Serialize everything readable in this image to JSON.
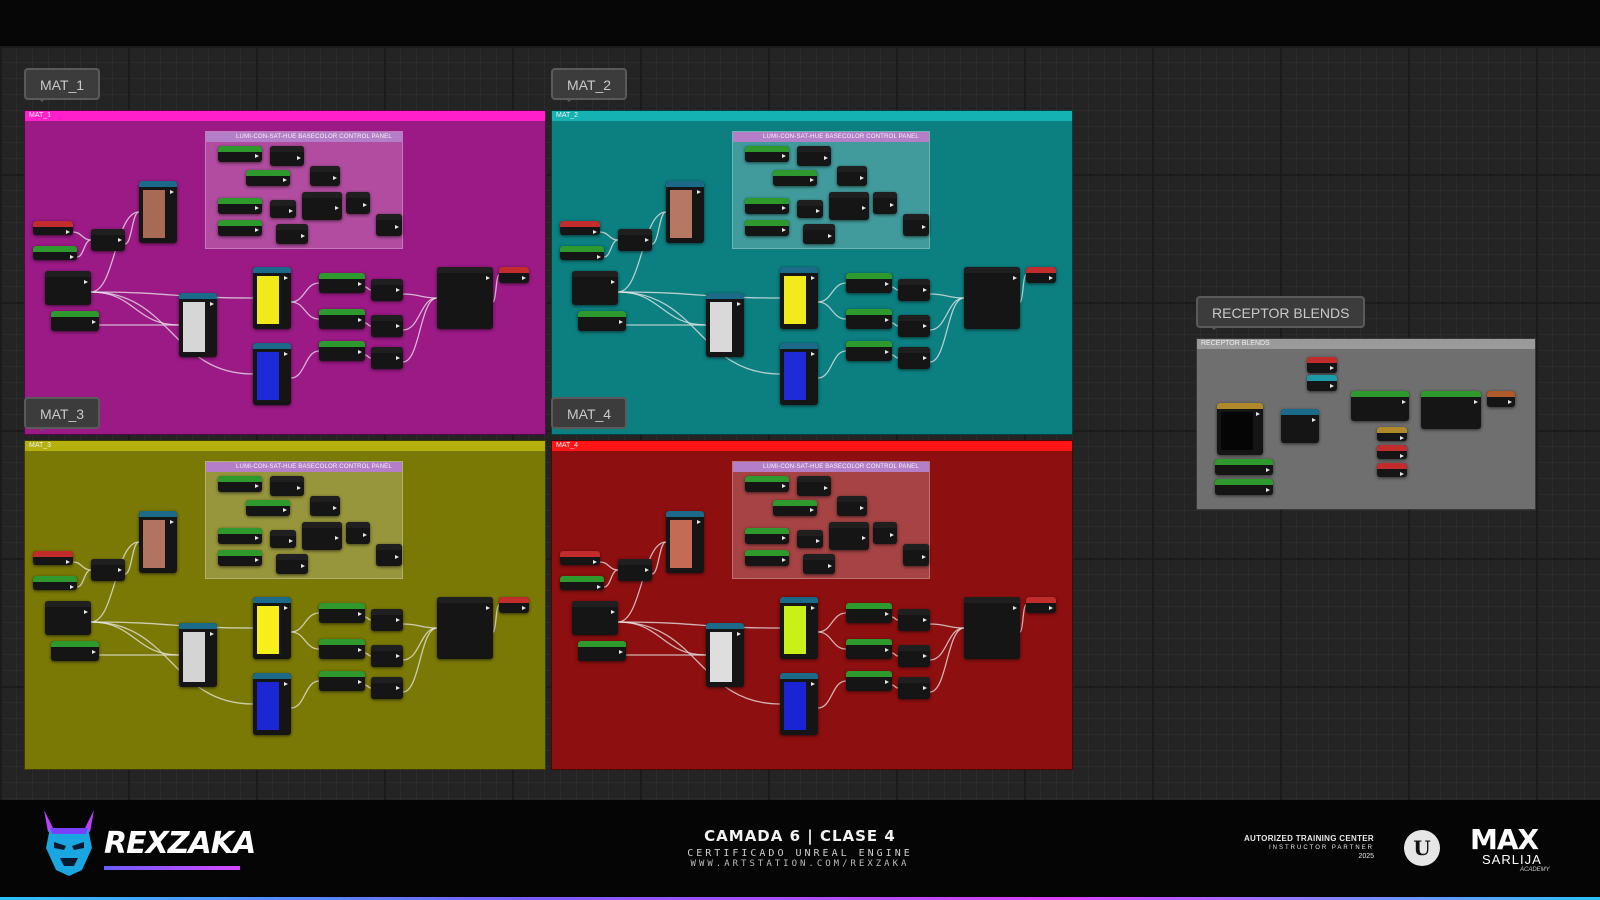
{
  "graph": {
    "groups": [
      {
        "tag": "MAT_1",
        "bar_label": "MAT_1",
        "color": "#9b1a86",
        "bar_color": "#ff1fcb",
        "swatches": [
          "#a86a54",
          "#f0e91c",
          "#d6d6d6",
          "#1c2ad8"
        ]
      },
      {
        "tag": "MAT_2",
        "bar_label": "MAT_2",
        "color": "#0c7f80",
        "bar_color": "#14b2b2",
        "swatches": [
          "#b67863",
          "#f4e91a",
          "#d9d9d9",
          "#1f2ad8"
        ]
      },
      {
        "tag": "MAT_3",
        "bar_label": "MAT_3",
        "color": "#7b7906",
        "bar_color": "#b4b10e",
        "swatches": [
          "#b27461",
          "#f8ef1a",
          "#d4d4d4",
          "#1b27d2"
        ]
      },
      {
        "tag": "MAT_4",
        "bar_label": "MAT_4",
        "color": "#8d0f10",
        "bar_color": "#ff1515",
        "swatches": [
          "#c46a55",
          "#c9f017",
          "#dedede",
          "#1a24d4"
        ]
      }
    ],
    "panel_title": "LUMI-CON-SAT-HUE BASECOLOR CONTROL PANEL",
    "receptor": {
      "tag": "RECEPTOR BLENDS",
      "bar_label": "RECEPTOR BLENDS",
      "color": "#6f6f6f",
      "bar_color": "#9a9a9a"
    }
  },
  "banner": {
    "brand": "REXZAKA",
    "title": "CAMADA 6 | CLASE 4",
    "subtitle": "CERTIFICADO UNREAL ENGINE",
    "url": "WWW.ARTSTATION.COM/REXZAKA",
    "atc_line1": "AUTORIZED TRAINING CENTER",
    "atc_line2": "INSTRUCTOR PARTNER",
    "atc_year": "2025",
    "ue_glyph": "U",
    "partner_name": "MAX",
    "partner_sub": "SARLIJA",
    "partner_tag": "ACADEMY",
    "icons": [
      "demon-mask-icon",
      "unreal-engine-logo-icon"
    ]
  }
}
